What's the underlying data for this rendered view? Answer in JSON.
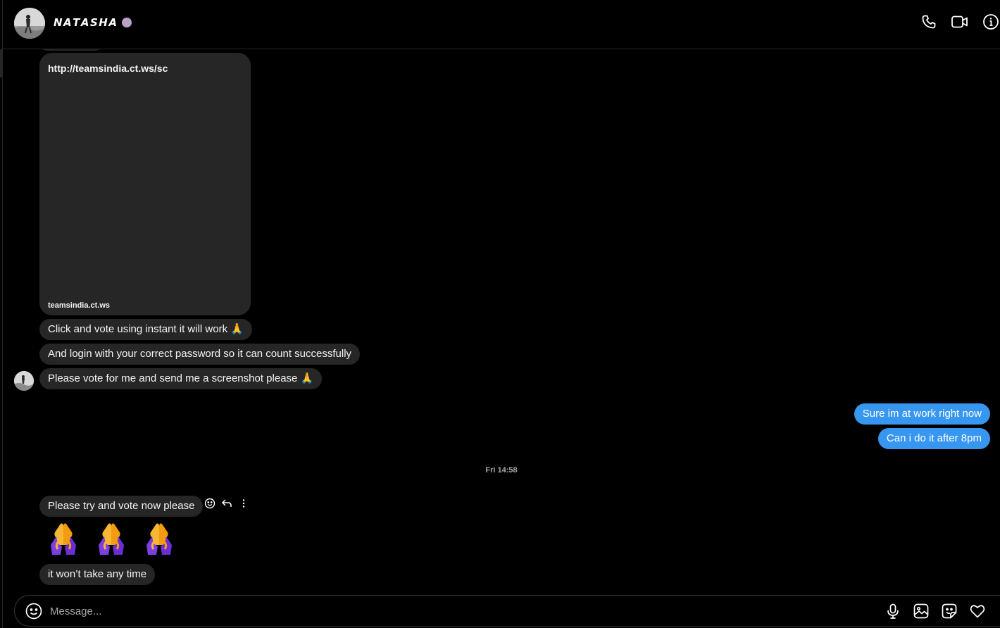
{
  "header": {
    "contact_name": "𝙉𝘼𝙏𝘼𝙎𝙃𝘼",
    "icons": [
      "phone-icon",
      "video-camera-icon",
      "info-icon"
    ]
  },
  "thread": {
    "link_preview": {
      "url": "http://teamsindia.ct.ws/sc",
      "domain": "teamsindia.ct.ws"
    },
    "incoming_1": "Click and vote using instant it will work 🙏",
    "incoming_2": "And login with your correct password so it can count successfully",
    "incoming_3": "Please vote for me and send me a screenshot please 🙏",
    "outgoing_1": "Sure im at work right now",
    "outgoing_2": "Can i do it after 8pm",
    "timestamp": "Fri 14:58",
    "incoming_4": "Please try and vote now please",
    "emoji_count": 3,
    "incoming_5": "it won’t take any time"
  },
  "composer": {
    "placeholder": "Message...",
    "icons": [
      "emoji-icon",
      "microphone-icon",
      "image-icon",
      "sticker-icon",
      "heart-icon"
    ]
  },
  "colors": {
    "background": "#000000",
    "incoming_bubble": "#262626",
    "outgoing_bubble": "#3797f0",
    "muted_text": "#a8a8a8"
  }
}
